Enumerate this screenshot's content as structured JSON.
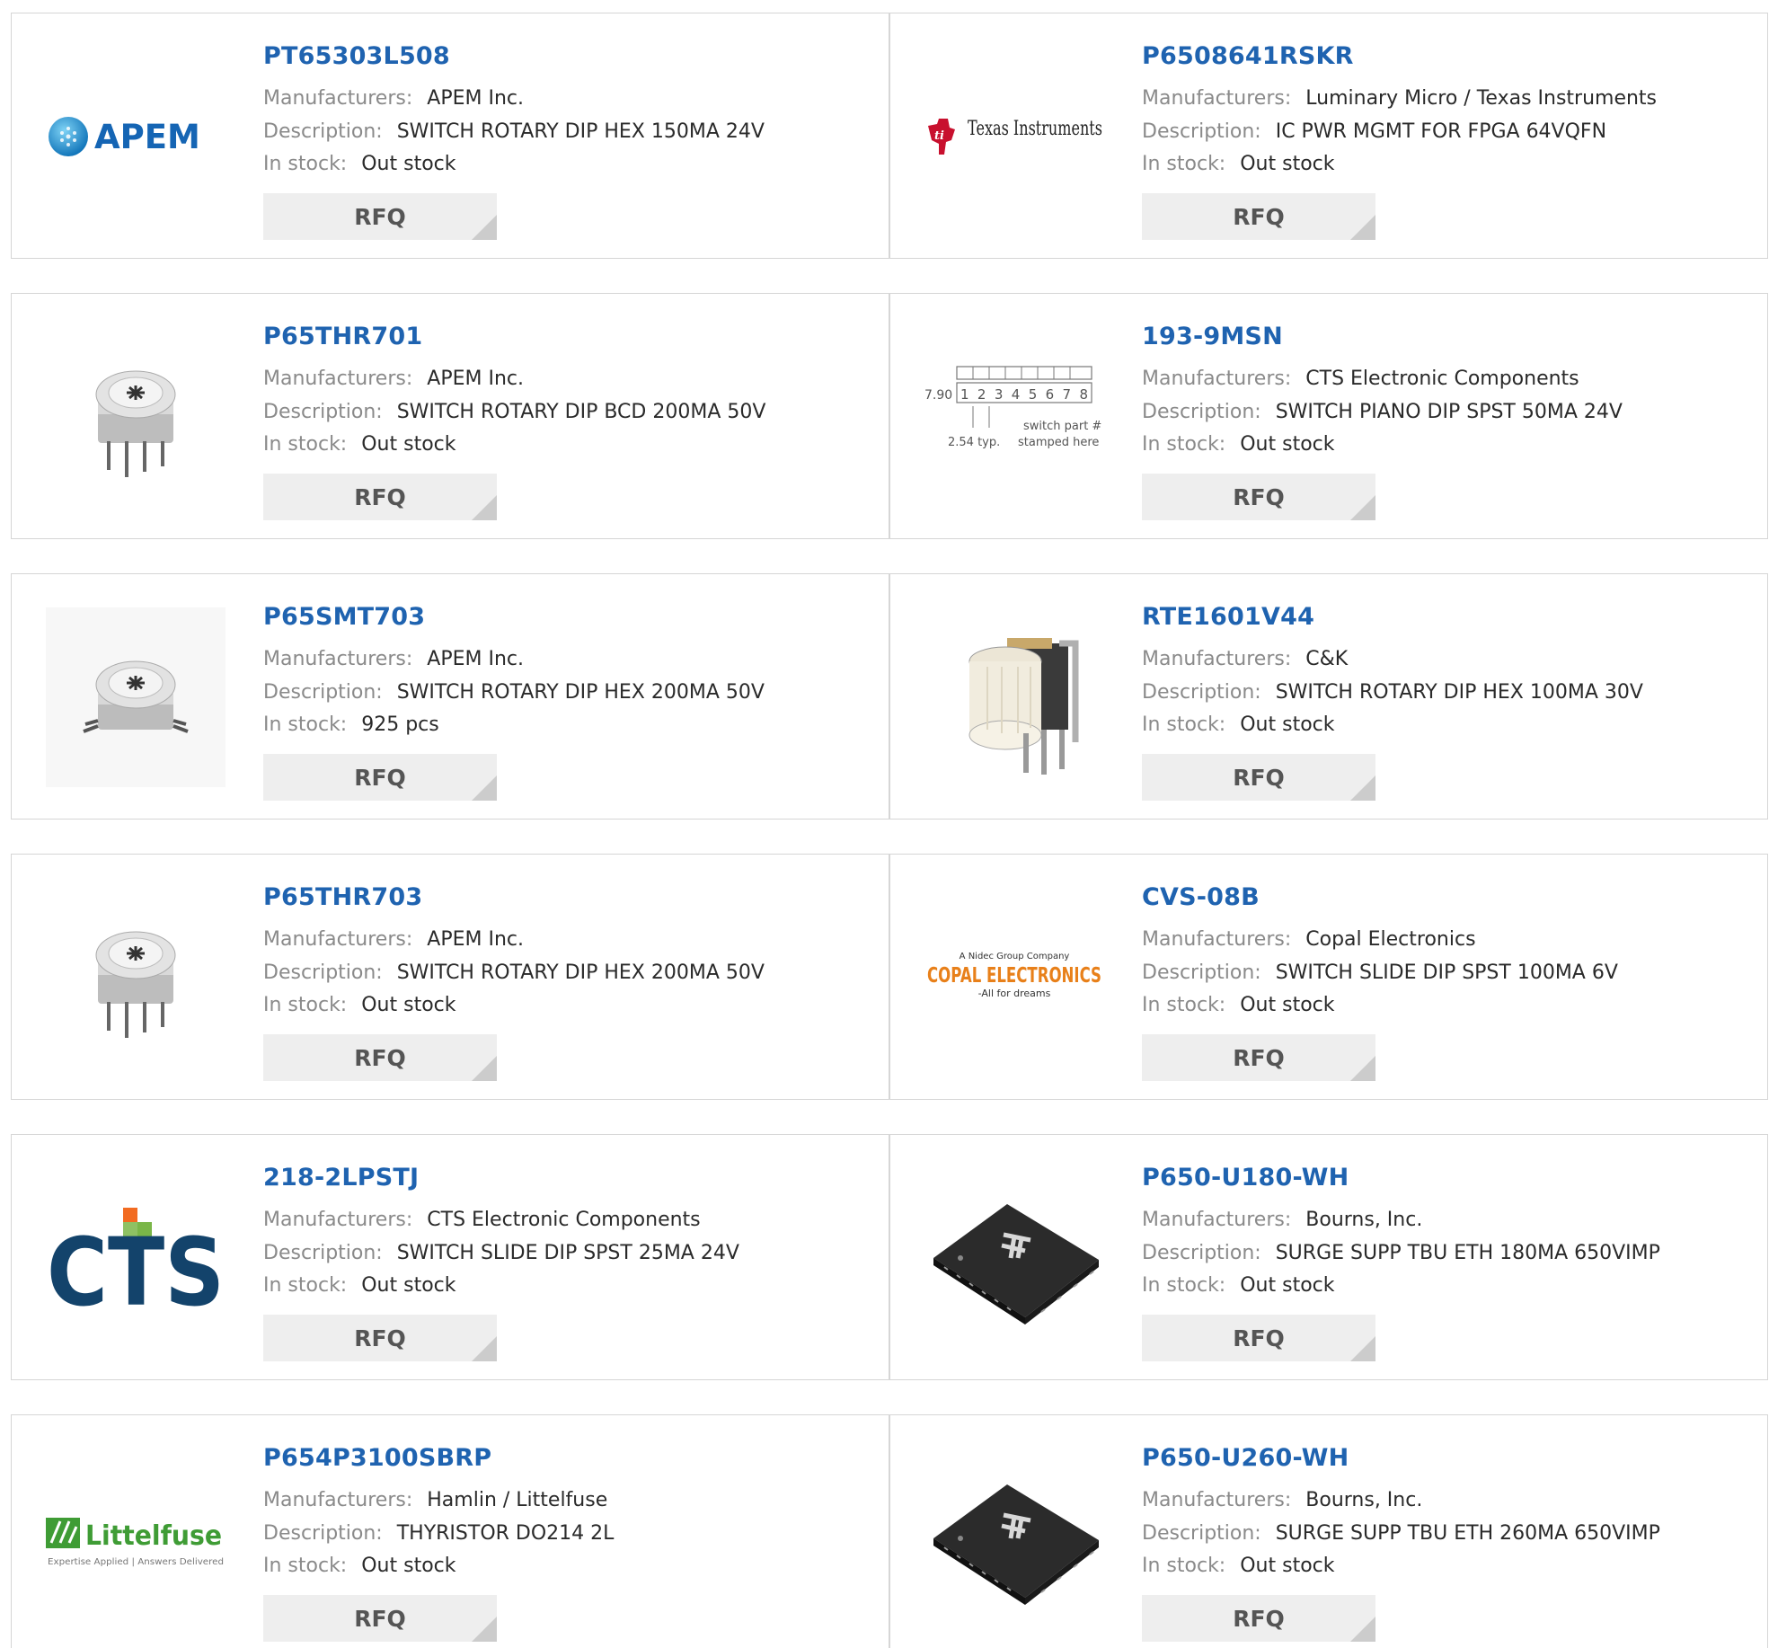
{
  "labels": {
    "manufacturers": "Manufacturers:",
    "description": "Description:",
    "in_stock": "In stock:",
    "rfq": "RFQ"
  },
  "colors": {
    "part_link": "#1f63b0",
    "rfq_bg": "#eeeeee",
    "border": "#d6d6d6"
  },
  "products": [
    {
      "part": "PT65303L508",
      "manufacturer": "APEM Inc.",
      "description": "SWITCH ROTARY DIP HEX 150MA 24V",
      "stock": "Out stock",
      "image": "apem-logo",
      "logo_text": "APEM"
    },
    {
      "part": "P6508641RSKR",
      "manufacturer": "Luminary Micro / Texas Instruments",
      "description": "IC PWR MGMT FOR FPGA 64VQFN",
      "stock": "Out stock",
      "image": "texas-instruments-logo",
      "logo_text": "Texas Instruments"
    },
    {
      "part": "P65THR701",
      "manufacturer": "APEM Inc.",
      "description": "SWITCH ROTARY DIP BCD 200MA 50V",
      "stock": "Out stock",
      "image": "rotary-switch-thru-hole-photo"
    },
    {
      "part": "193-9MSN",
      "manufacturer": "CTS Electronic Components",
      "description": "SWITCH PIANO DIP SPST 50MA 24V",
      "stock": "Out stock",
      "image": "dip-switch-drawing",
      "drawing_text": {
        "height": "7.90",
        "positions": "1 2 3 4 5 6 7 8",
        "pitch": "2.54 typ.",
        "note_1": "switch part #",
        "note_2": "stamped here"
      }
    },
    {
      "part": "P65SMT703",
      "manufacturer": "APEM Inc.",
      "description": "SWITCH ROTARY DIP HEX 200MA 50V",
      "stock": "925 pcs",
      "image": "rotary-switch-smt-photo"
    },
    {
      "part": "RTE1601V44",
      "manufacturer": "C&K",
      "description": "SWITCH ROTARY DIP HEX 100MA 30V",
      "stock": "Out stock",
      "image": "rotary-knob-switch-photo"
    },
    {
      "part": "P65THR703",
      "manufacturer": "APEM Inc.",
      "description": "SWITCH ROTARY DIP HEX 200MA 50V",
      "stock": "Out stock",
      "image": "rotary-switch-thru-hole-photo"
    },
    {
      "part": "CVS-08B",
      "manufacturer": "Copal Electronics",
      "description": "SWITCH SLIDE DIP SPST 100MA 6V",
      "stock": "Out stock",
      "image": "copal-electronics-logo",
      "logo_text": {
        "top": "A Nidec Group Company",
        "main": "COPAL ELECTRONICS",
        "tag": "-All for dreams"
      }
    },
    {
      "part": "218-2LPSTJ",
      "manufacturer": "CTS Electronic Components",
      "description": "SWITCH SLIDE DIP SPST 25MA 24V",
      "stock": "Out stock",
      "image": "cts-logo",
      "logo_text": "CTS"
    },
    {
      "part": "P650-U180-WH",
      "manufacturer": "Bourns, Inc.",
      "description": "SURGE SUPP TBU ETH 180MA 650VIMP",
      "stock": "Out stock",
      "image": "chip-package-photo"
    },
    {
      "part": "P654P3100SBRP",
      "manufacturer": "Hamlin / Littelfuse",
      "description": "THYRISTOR DO214 2L",
      "stock": "Out stock",
      "image": "littelfuse-logo",
      "logo_text": {
        "main": "Littelfuse",
        "tag": "Expertise Applied | Answers Delivered"
      }
    },
    {
      "part": "P650-U260-WH",
      "manufacturer": "Bourns, Inc.",
      "description": "SURGE SUPP TBU ETH 260MA 650VIMP",
      "stock": "Out stock",
      "image": "chip-package-photo"
    }
  ]
}
